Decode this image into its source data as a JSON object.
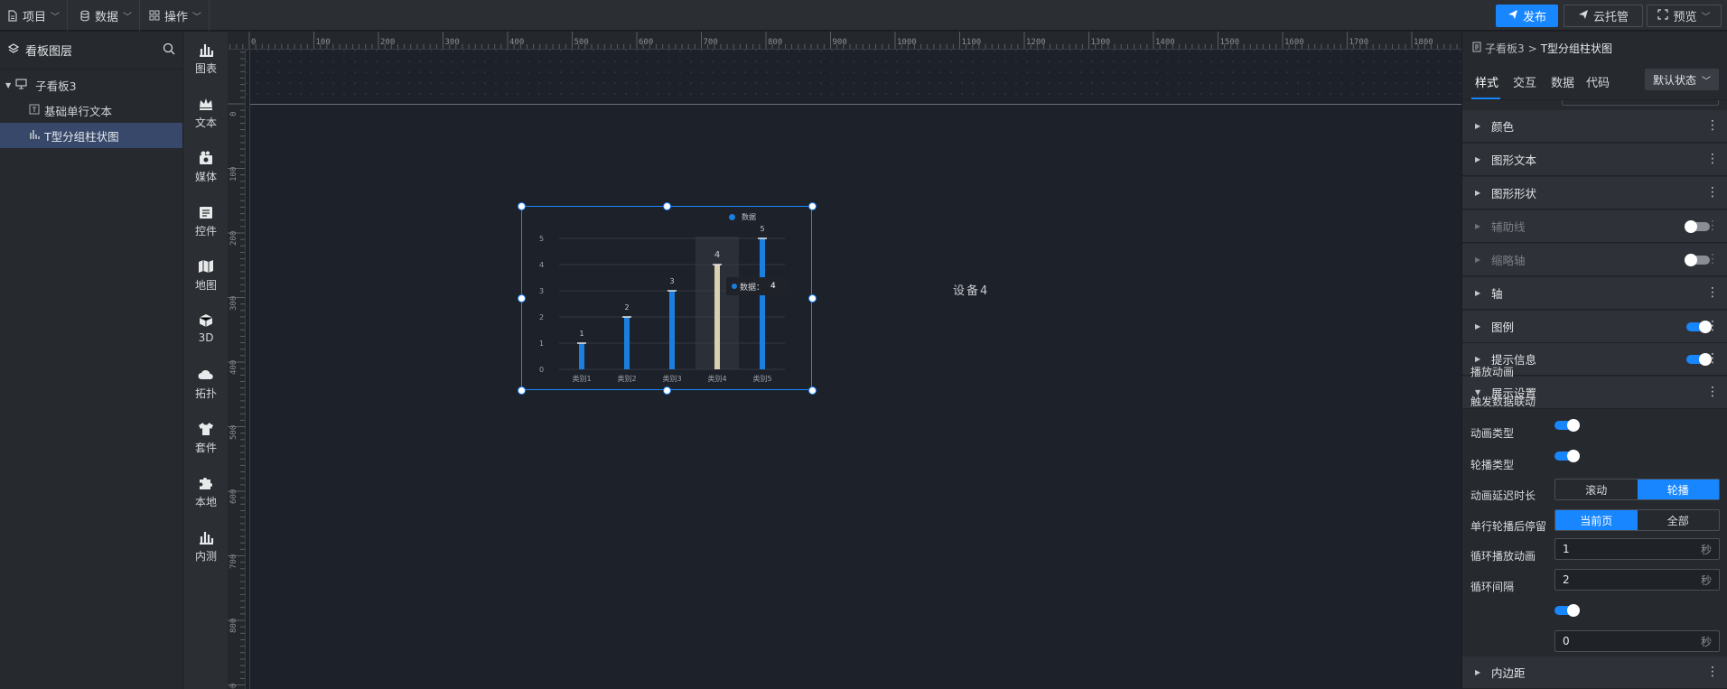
{
  "topbar": {
    "menus": [
      {
        "label": "项目",
        "icon": "file-icon"
      },
      {
        "label": "数据",
        "icon": "database-icon"
      },
      {
        "label": "操作",
        "icon": "grid-icon"
      }
    ],
    "publish_label": "发布",
    "cloud_label": "云托管",
    "preview_label": "预览"
  },
  "layers": {
    "title": "看板图层",
    "root": "子看板3",
    "items": [
      "基础单行文本",
      "T型分组柱状图"
    ]
  },
  "components": [
    "图表",
    "文本",
    "媒体",
    "控件",
    "地图",
    "3D",
    "拓扑",
    "套件",
    "本地",
    "内测"
  ],
  "ruler": {
    "top": [
      "0",
      "100",
      "200",
      "300",
      "400",
      "500",
      "600",
      "700",
      "800",
      "900",
      "1000",
      "1100",
      "1200",
      "1300",
      "1400",
      "1500",
      "1600",
      "1700",
      "1800",
      "1900"
    ],
    "left": [
      "0",
      "100",
      "200",
      "300",
      "400",
      "500",
      "600",
      "700",
      "800",
      "900"
    ]
  },
  "canvas": {
    "device_text": "设备4",
    "tooltip_label": "数据：",
    "tooltip_value": "4"
  },
  "chart_data": {
    "type": "bar",
    "categories": [
      "类别1",
      "类别2",
      "类别3",
      "类别4",
      "类别5"
    ],
    "series": [
      {
        "name": "数据",
        "values": [
          1,
          2,
          3,
          4,
          5
        ]
      }
    ],
    "ylim": [
      0,
      5
    ],
    "yticks": [
      "0",
      "1",
      "2",
      "3",
      "4",
      "5"
    ],
    "data_labels": [
      "1",
      "2",
      "3",
      "4",
      "5"
    ],
    "legend_position": "top-right",
    "highlighted_index": 3,
    "colors": {
      "bar": "#1a7fde",
      "highlight": "#d9cfb2",
      "grid": "#3b4049"
    }
  },
  "properties": {
    "breadcrumb_root": "子看板3",
    "breadcrumb_sep": ">",
    "breadcrumb_current": "T型分组柱状图",
    "tabs": [
      "样式",
      "交互",
      "数据",
      "代码"
    ],
    "state_label": "默认状态",
    "sections": [
      {
        "label": "颜色",
        "dim": false,
        "toggle": null
      },
      {
        "label": "图形文本",
        "dim": false,
        "toggle": null
      },
      {
        "label": "图形形状",
        "dim": false,
        "toggle": null
      },
      {
        "label": "辅助线",
        "dim": true,
        "toggle": "off"
      },
      {
        "label": "缩略轴",
        "dim": true,
        "toggle": "off"
      },
      {
        "label": "轴",
        "dim": false,
        "toggle": null
      },
      {
        "label": "图例",
        "dim": false,
        "toggle": "on"
      },
      {
        "label": "提示信息",
        "dim": false,
        "toggle": "on"
      },
      {
        "label": "展示设置",
        "dim": false,
        "toggle": null
      }
    ],
    "display": {
      "play_anim": "播放动画",
      "trigger_link": "触发数据联动",
      "anim_type": "动画类型",
      "anim_options": [
        "滚动",
        "轮播"
      ],
      "anim_selected": "轮播",
      "carousel_type": "轮播类型",
      "carousel_options": [
        "当前页",
        "全部"
      ],
      "carousel_selected": "当前页",
      "delay_label": "动画延迟时长",
      "delay_value": "1",
      "stay_label": "单行轮播后停留",
      "stay_value": "2",
      "loop_label": "循环播放动画",
      "interval_label": "循环间隔",
      "interval_value": "0",
      "unit": "秒"
    },
    "last_section": "内边距"
  }
}
